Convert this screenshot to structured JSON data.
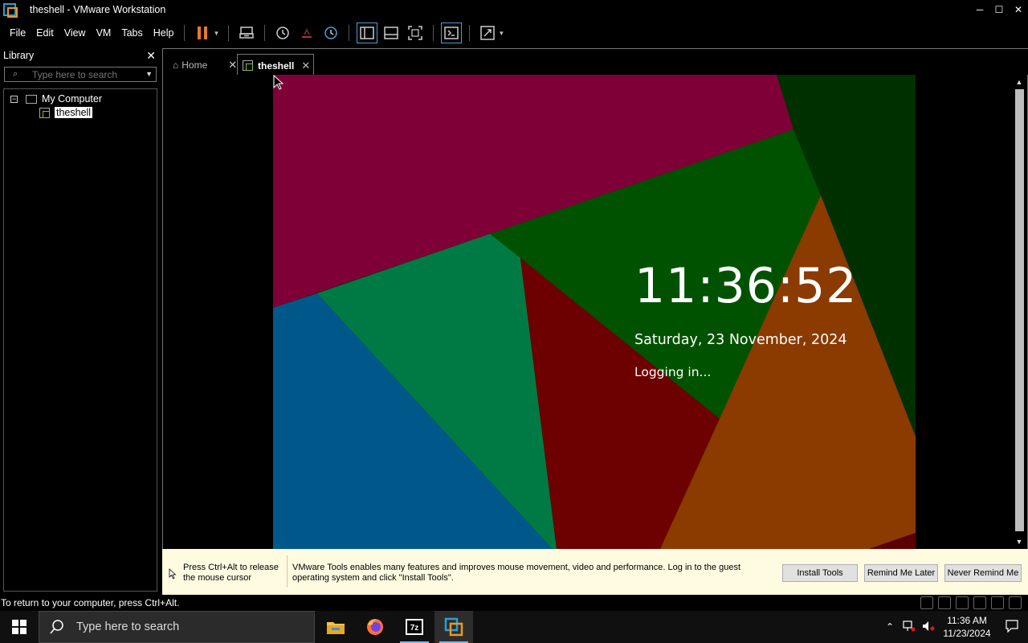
{
  "window": {
    "title": "theshell - VMware Workstation",
    "minimize": "─",
    "maximize": "☐",
    "close": "✕"
  },
  "menu": [
    "File",
    "Edit",
    "View",
    "VM",
    "Tabs",
    "Help"
  ],
  "library": {
    "header": "Library",
    "close": "✕",
    "search_placeholder": "Type here to search",
    "tree": {
      "root_label": "My Computer",
      "expander": "−",
      "child_label": "theshell"
    }
  },
  "tabs": {
    "home_label": "Home",
    "vm_label": "theshell",
    "close_glyph": "✕"
  },
  "guest": {
    "time": "11:36:52",
    "date": "Saturday, 23 November, 2024",
    "status": "Logging in...",
    "colors": {
      "magenta": "#7f0036",
      "green": "#005200",
      "dark_green": "#003000",
      "teal": "#007a45",
      "blue": "#00588a",
      "maroon": "#6d0000",
      "orange": "#8b3a00"
    }
  },
  "hint_bar": {
    "release_text": "Press Ctrl+Alt to release the mouse cursor",
    "message": "VMware Tools enables many features and improves mouse movement, video and performance. Log in to the guest operating system and click \"Install Tools\".",
    "install_button": "Install Tools",
    "remind_later_button": "Remind Me Later",
    "never_remind_button": "Never Remind Me"
  },
  "status_bar": {
    "message": "To return to your computer, press Ctrl+Alt."
  },
  "taskbar": {
    "search_placeholder": "Type here to search",
    "time": "11:36 AM",
    "date": "11/23/2024",
    "apps": [
      "file-explorer",
      "firefox",
      "7zip",
      "vmware-workstation"
    ]
  }
}
